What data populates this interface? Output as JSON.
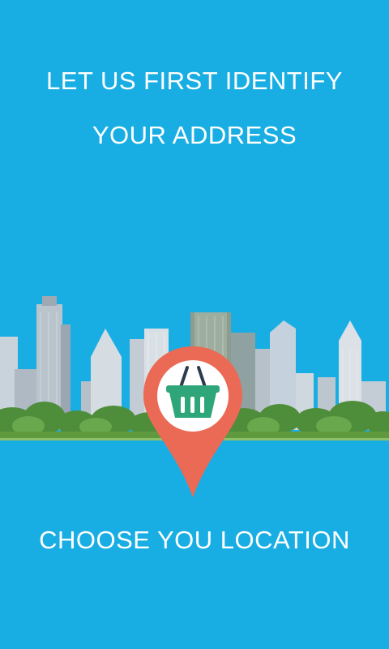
{
  "headline": {
    "line1": "LET US FIRST IDENTIFY",
    "line2": "YOUR ADDRESS"
  },
  "illustration": {
    "skyline": "city-skyline-illustration",
    "marker": "location-pin-icon",
    "basket": "shopping-basket-icon"
  },
  "cta": {
    "label": "CHOOSE YOU LOCATION"
  },
  "colors": {
    "background": "#19aee3",
    "text": "#ffffff",
    "pin": "#ea6a55",
    "basket": "#2fa57a"
  }
}
